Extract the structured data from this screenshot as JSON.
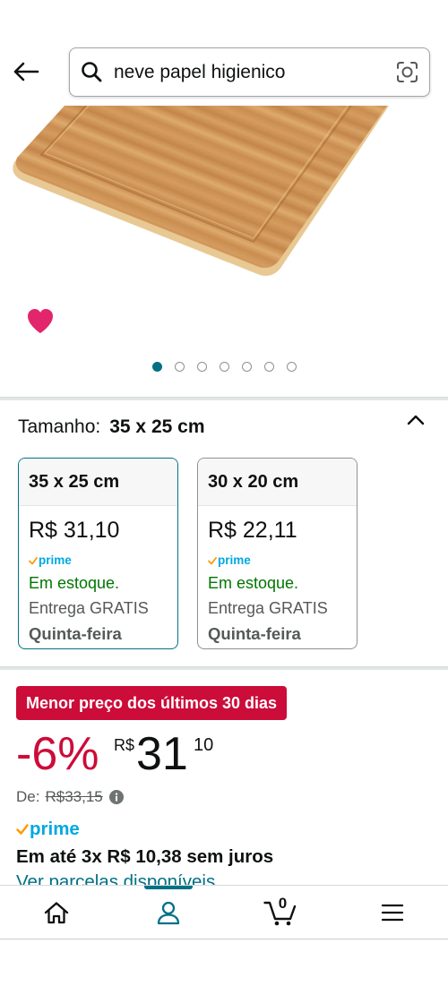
{
  "header": {
    "search_value": "neve papel higienico",
    "icons": [
      "back-arrow-icon",
      "search-icon",
      "camera-search-icon"
    ]
  },
  "product": {
    "wishlist_icon": "heart-icon"
  },
  "carousel": {
    "dot_count": 7,
    "active_index": 0
  },
  "size_selector": {
    "label": "Tamanho:",
    "selected": "35 x 25 cm",
    "expand_icon": "chevron-up-icon",
    "options": [
      {
        "name": "35 x 25 cm",
        "price": "R$ 31,10",
        "prime": "prime",
        "stock": "Em estoque.",
        "delivery": "Entrega GRATIS",
        "day": "Quinta-feira",
        "selected": true
      },
      {
        "name": "30 x 20 cm",
        "price": "R$ 22,11",
        "prime": "prime",
        "stock": "Em estoque.",
        "delivery": "Entrega GRATIS",
        "day": "Quinta-feira",
        "selected": false
      }
    ]
  },
  "deal": {
    "badge": "Menor preço dos últimos 30 dias",
    "discount": "-6%",
    "currency": "R$",
    "price_whole": "31",
    "price_fraction": "10",
    "list_label": "De:",
    "list_price": "R$33,15",
    "info_icon": "info-icon",
    "prime": "prime",
    "installments": "Em até 3x R$ 10,38 sem juros",
    "installments_link": "Ver parcelas disponíveis"
  },
  "bottom_nav": {
    "items": [
      "home-icon",
      "account-icon",
      "cart-icon",
      "menu-icon"
    ],
    "active": "account-icon",
    "cart_count": "0"
  },
  "colors": {
    "accent": "#007185",
    "deal_red": "#CC0C39",
    "stock_green": "#007600",
    "wishlist_pink": "#E3256B",
    "prime_blue": "#00A8E1",
    "prime_check": "#FF9900",
    "text": "#0F1111",
    "secondary_text": "#565959"
  }
}
